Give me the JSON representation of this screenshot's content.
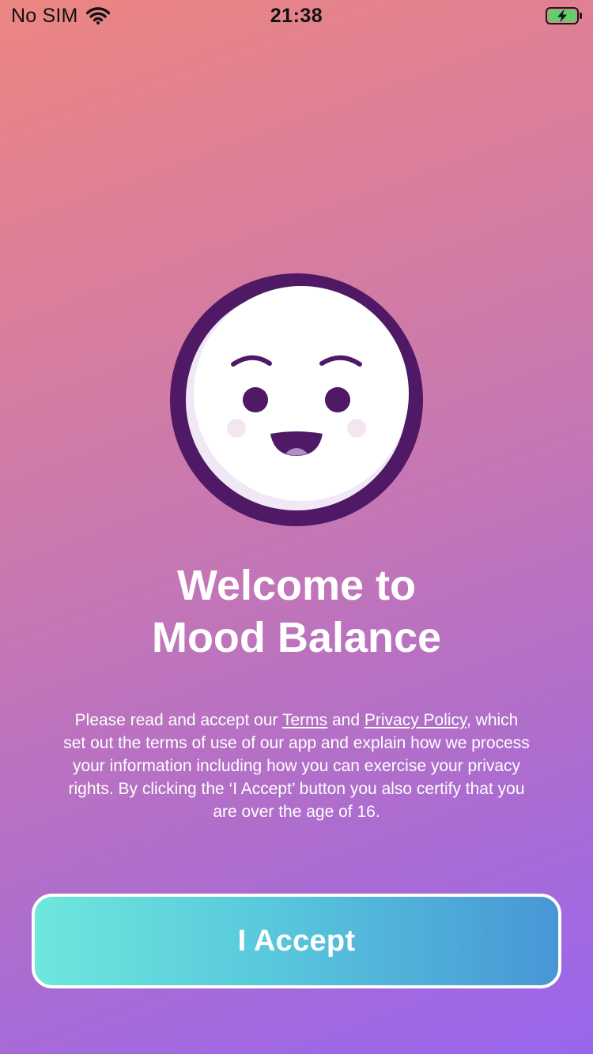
{
  "status_bar": {
    "carrier": "No SIM",
    "time": "21:38",
    "wifi_icon": "wifi-icon",
    "battery_icon": "battery-charging-icon"
  },
  "illustration": {
    "icon": "smiling-face-icon",
    "ring_color": "#4f1966"
  },
  "welcome": {
    "title_line1": "Welcome to",
    "title_line2": "Mood Balance"
  },
  "consent": {
    "text_before_terms": "Please read and accept our ",
    "terms_link": "Terms",
    "text_and": " and ",
    "privacy_link": "Privacy Policy",
    "text_after": ", which set out the terms of use of our app and explain how we process your information including how you can exercise your privacy rights. By clicking the ‘I Accept’ button you also certify that you are over the age of 16."
  },
  "accept_button": {
    "label": "I Accept"
  },
  "colors": {
    "gradient_top": "#ec8682",
    "gradient_bottom": "#9865ee",
    "button_start": "#6ee7dd",
    "button_end": "#4896d6"
  }
}
